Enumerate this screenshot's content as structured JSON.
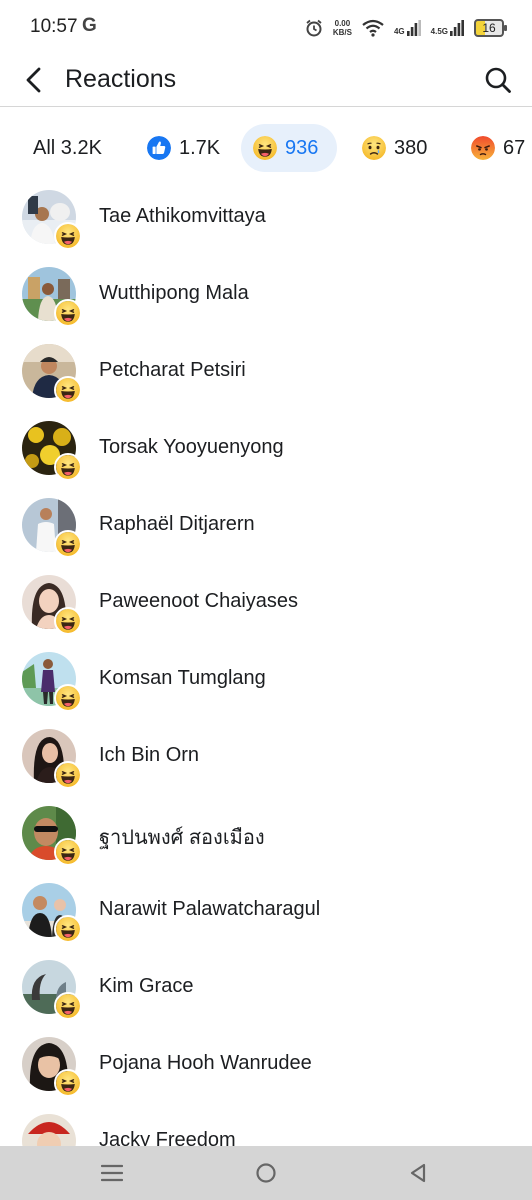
{
  "status_bar": {
    "time": "10:57",
    "carrier_icon": "G",
    "speed": "0.00",
    "speed_unit": "KB/S",
    "net1": "4G",
    "net2": "4.5G",
    "battery": "16"
  },
  "header": {
    "title": "Reactions"
  },
  "tabs": [
    {
      "label": "All 3.2K",
      "icon": ""
    },
    {
      "label": "1.7K",
      "icon": "like-icon"
    },
    {
      "label": "936",
      "icon": "haha-icon"
    },
    {
      "label": "380",
      "icon": "sad-icon"
    },
    {
      "label": "67",
      "icon": "angry-icon"
    }
  ],
  "people": [
    {
      "name": "Tae Athikomvittaya"
    },
    {
      "name": "Wutthipong Mala"
    },
    {
      "name": "Petcharat Petsiri"
    },
    {
      "name": "Torsak Yooyuenyong"
    },
    {
      "name": "Raphaël Ditjarern"
    },
    {
      "name": "Paweenoot Chaiyases"
    },
    {
      "name": "Komsan Tumglang"
    },
    {
      "name": "Ich Bin Orn"
    },
    {
      "name": "ฐาปนพงศ์ สองเมือง"
    },
    {
      "name": "Narawit Palawatcharagul"
    },
    {
      "name": "Kim Grace"
    },
    {
      "name": "Pojana Hooh Wanrudee"
    },
    {
      "name": "Jacky Freedom"
    }
  ],
  "colors": {
    "accent": "#1877f2",
    "active_tab_bg": "#e7f0fb",
    "haha": "#f7c33a",
    "like": "#1877f2",
    "angry": "#e9710f",
    "navbar": "#d5d5d5"
  }
}
